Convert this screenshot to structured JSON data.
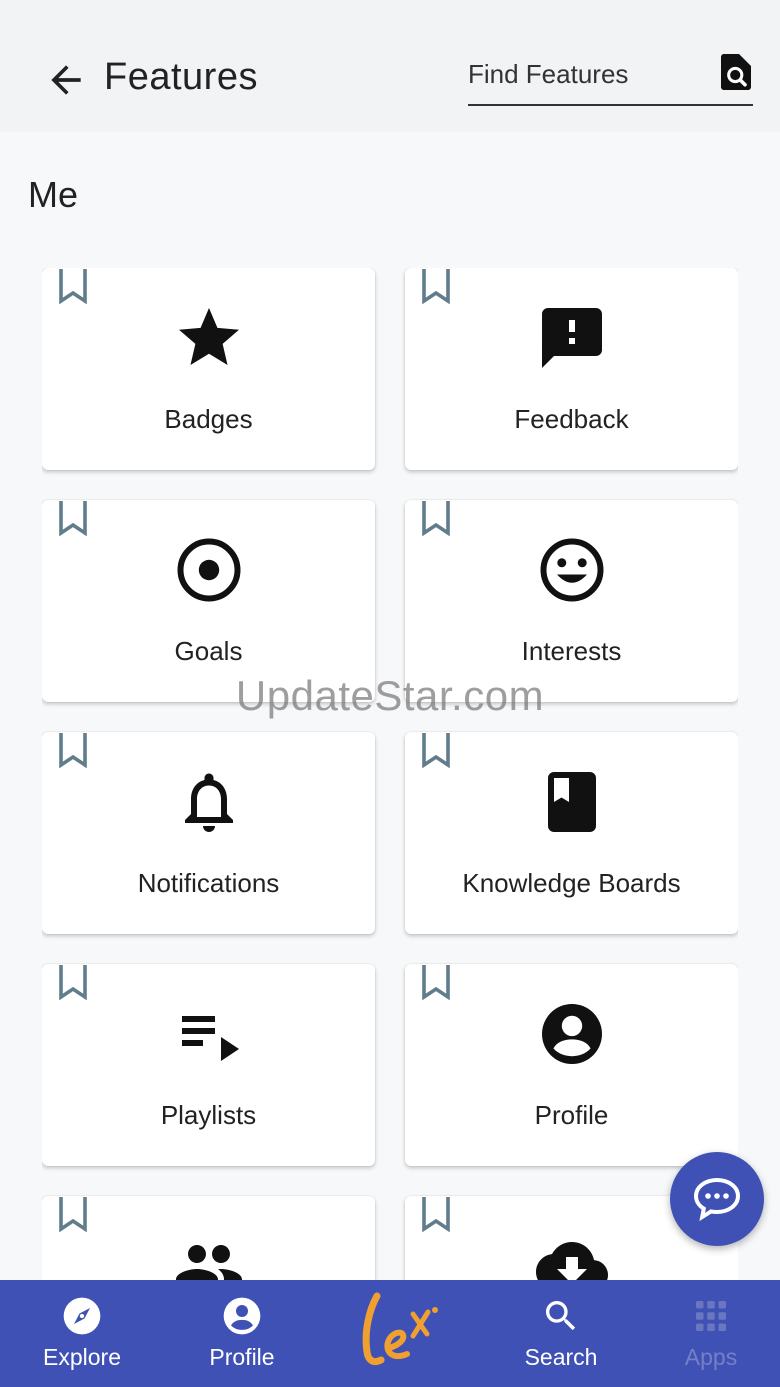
{
  "header": {
    "title": "Features",
    "search_placeholder": "Find Features"
  },
  "section": {
    "title": "Me"
  },
  "cards": [
    {
      "label": "Badges",
      "icon": "star-icon"
    },
    {
      "label": "Feedback",
      "icon": "feedback-icon"
    },
    {
      "label": "Goals",
      "icon": "target-icon"
    },
    {
      "label": "Interests",
      "icon": "smiley-icon"
    },
    {
      "label": "Notifications",
      "icon": "bell-icon"
    },
    {
      "label": "Knowledge Boards",
      "icon": "book-icon"
    },
    {
      "label": "Playlists",
      "icon": "playlist-icon"
    },
    {
      "label": "Profile",
      "icon": "account-circle-icon"
    },
    {
      "label": "",
      "icon": "people-icon"
    },
    {
      "label": "",
      "icon": "cloud-download-icon"
    }
  ],
  "watermark": "UpdateStar.com",
  "bottom_nav": {
    "items": [
      {
        "label": "Explore",
        "icon": "compass-icon"
      },
      {
        "label": "Profile",
        "icon": "person-icon"
      },
      {
        "label": "Search",
        "icon": "search-icon"
      },
      {
        "label": "Apps",
        "icon": "apps-grid-icon"
      }
    ],
    "logo_text": "lex"
  },
  "colors": {
    "primary": "#3f51b5",
    "bookmark": "#607d8b",
    "logo": "#f0a030"
  }
}
